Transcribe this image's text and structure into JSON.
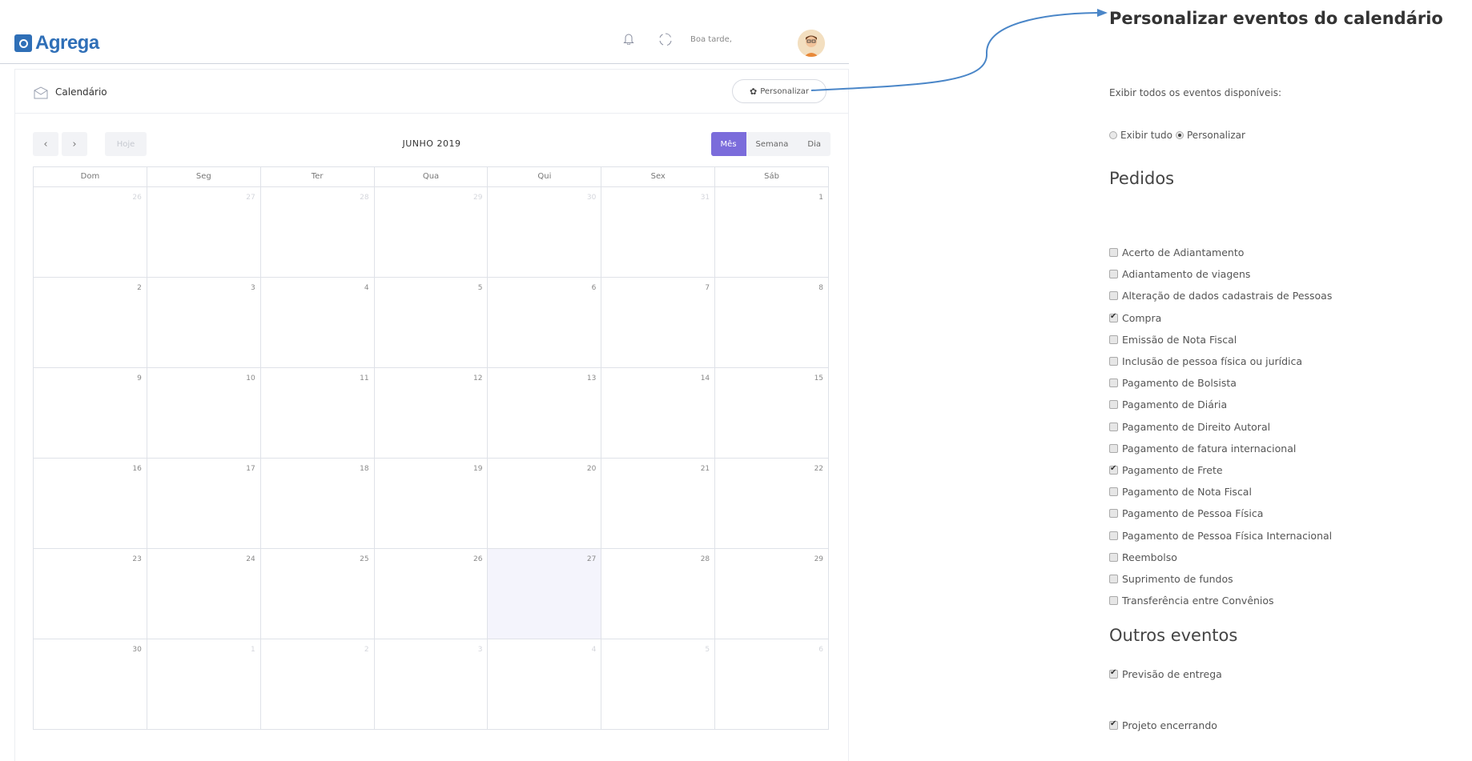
{
  "app": {
    "logo_text": "Agrega",
    "greeting": "Boa tarde,",
    "page_title": "Calendário",
    "personalize_label": "Personalizar",
    "nav_prev": "‹",
    "nav_next": "›",
    "today_label": "Hoje",
    "month_title": "JUNHO 2019",
    "views": [
      "Mês",
      "Semana",
      "Dia"
    ],
    "active_view": "Mês",
    "weekdays": [
      "Dom",
      "Seg",
      "Ter",
      "Qua",
      "Qui",
      "Sex",
      "Sáb"
    ],
    "weeks": [
      [
        {
          "d": "26",
          "other": true
        },
        {
          "d": "27",
          "other": true
        },
        {
          "d": "28",
          "other": true
        },
        {
          "d": "29",
          "other": true
        },
        {
          "d": "30",
          "other": true
        },
        {
          "d": "31",
          "other": true
        },
        {
          "d": "1",
          "other": false
        }
      ],
      [
        {
          "d": "2",
          "other": false
        },
        {
          "d": "3",
          "other": false
        },
        {
          "d": "4",
          "other": false
        },
        {
          "d": "5",
          "other": false
        },
        {
          "d": "6",
          "other": false
        },
        {
          "d": "7",
          "other": false
        },
        {
          "d": "8",
          "other": false
        }
      ],
      [
        {
          "d": "9",
          "other": false
        },
        {
          "d": "10",
          "other": false
        },
        {
          "d": "11",
          "other": false
        },
        {
          "d": "12",
          "other": false
        },
        {
          "d": "13",
          "other": false
        },
        {
          "d": "14",
          "other": false
        },
        {
          "d": "15",
          "other": false
        }
      ],
      [
        {
          "d": "16",
          "other": false
        },
        {
          "d": "17",
          "other": false
        },
        {
          "d": "18",
          "other": false
        },
        {
          "d": "19",
          "other": false
        },
        {
          "d": "20",
          "other": false
        },
        {
          "d": "21",
          "other": false
        },
        {
          "d": "22",
          "other": false
        }
      ],
      [
        {
          "d": "23",
          "other": false
        },
        {
          "d": "24",
          "other": false
        },
        {
          "d": "25",
          "other": false
        },
        {
          "d": "26",
          "other": false
        },
        {
          "d": "27",
          "other": false,
          "today": true
        },
        {
          "d": "28",
          "other": false
        },
        {
          "d": "29",
          "other": false
        }
      ],
      [
        {
          "d": "30",
          "other": false
        },
        {
          "d": "1",
          "other": true
        },
        {
          "d": "2",
          "other": true
        },
        {
          "d": "3",
          "other": true
        },
        {
          "d": "4",
          "other": true
        },
        {
          "d": "5",
          "other": true
        },
        {
          "d": "6",
          "other": true
        }
      ]
    ]
  },
  "panel": {
    "title": "Personalizar eventos do calendário",
    "show_all_text": "Exibir todos os eventos disponíveis:",
    "radio_options": [
      {
        "label": "Exibir tudo",
        "selected": false
      },
      {
        "label": "Personalizar",
        "selected": true
      }
    ],
    "orders_heading": "Pedidos",
    "orders": [
      {
        "label": "Acerto de Adiantamento",
        "checked": false
      },
      {
        "label": "Adiantamento de viagens",
        "checked": false
      },
      {
        "label": "Alteração de dados cadastrais de Pessoas",
        "checked": false
      },
      {
        "label": "Compra",
        "checked": true
      },
      {
        "label": "Emissão de Nota Fiscal",
        "checked": false
      },
      {
        "label": "Inclusão de pessoa física ou jurídica",
        "checked": false
      },
      {
        "label": "Pagamento de Bolsista",
        "checked": false
      },
      {
        "label": "Pagamento de Diária",
        "checked": false
      },
      {
        "label": "Pagamento de Direito Autoral",
        "checked": false
      },
      {
        "label": "Pagamento de fatura internacional",
        "checked": false
      },
      {
        "label": "Pagamento de Frete",
        "checked": true
      },
      {
        "label": "Pagamento de Nota Fiscal",
        "checked": false
      },
      {
        "label": "Pagamento de Pessoa Física",
        "checked": false
      },
      {
        "label": "Pagamento de Pessoa Física Internacional",
        "checked": false
      },
      {
        "label": "Reembolso",
        "checked": false
      },
      {
        "label": "Suprimento de fundos",
        "checked": false
      },
      {
        "label": "Transferência entre Convênios",
        "checked": false
      }
    ],
    "other_heading": "Outros eventos",
    "other_events": [
      {
        "label": "Previsão de entrega",
        "checked": true
      },
      {
        "label": "Projeto encerrando",
        "checked": true
      }
    ]
  },
  "colors": {
    "brand": "#2f6fb7",
    "active_view": "#7b6cdb",
    "today_bg": "#f4f4fc",
    "connector": "#4a86c8"
  }
}
